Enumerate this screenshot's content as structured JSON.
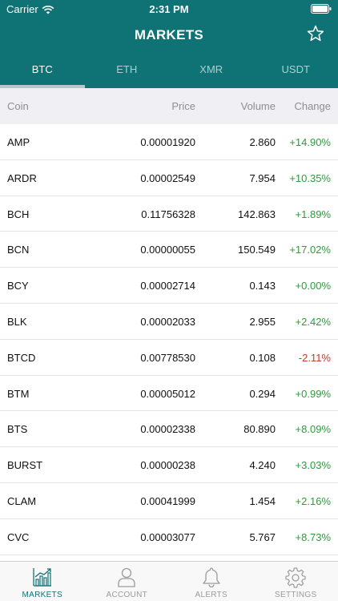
{
  "status": {
    "carrier": "Carrier",
    "time": "2:31 PM"
  },
  "header": {
    "title": "MARKETS"
  },
  "tabs": [
    {
      "label": "BTC",
      "active": true
    },
    {
      "label": "ETH"
    },
    {
      "label": "XMR"
    },
    {
      "label": "USDT"
    }
  ],
  "columns": {
    "coin": "Coin",
    "price": "Price",
    "volume": "Volume",
    "change": "Change"
  },
  "rows": [
    {
      "coin": "AMP",
      "price": "0.00001920",
      "volume": "2.860",
      "change": "+14.90%"
    },
    {
      "coin": "ARDR",
      "price": "0.00002549",
      "volume": "7.954",
      "change": "+10.35%"
    },
    {
      "coin": "BCH",
      "price": "0.11756328",
      "volume": "142.863",
      "change": "+1.89%"
    },
    {
      "coin": "BCN",
      "price": "0.00000055",
      "volume": "150.549",
      "change": "+17.02%"
    },
    {
      "coin": "BCY",
      "price": "0.00002714",
      "volume": "0.143",
      "change": "+0.00%"
    },
    {
      "coin": "BLK",
      "price": "0.00002033",
      "volume": "2.955",
      "change": "+2.42%"
    },
    {
      "coin": "BTCD",
      "price": "0.00778530",
      "volume": "0.108",
      "change": "-2.11%"
    },
    {
      "coin": "BTM",
      "price": "0.00005012",
      "volume": "0.294",
      "change": "+0.99%"
    },
    {
      "coin": "BTS",
      "price": "0.00002338",
      "volume": "80.890",
      "change": "+8.09%"
    },
    {
      "coin": "BURST",
      "price": "0.00000238",
      "volume": "4.240",
      "change": "+3.03%"
    },
    {
      "coin": "CLAM",
      "price": "0.00041999",
      "volume": "1.454",
      "change": "+2.16%"
    },
    {
      "coin": "CVC",
      "price": "0.00003077",
      "volume": "5.767",
      "change": "+8.73%"
    }
  ],
  "tabbar": [
    {
      "label": "MARKETS",
      "icon": "chart-icon",
      "active": true
    },
    {
      "label": "ACCOUNT",
      "icon": "person-icon"
    },
    {
      "label": "ALERTS",
      "icon": "bell-icon"
    },
    {
      "label": "SETTINGS",
      "icon": "gear-icon"
    }
  ],
  "colors": {
    "primary": "#0f7275",
    "positive": "#2e9b3c",
    "negative": "#c0392b"
  }
}
